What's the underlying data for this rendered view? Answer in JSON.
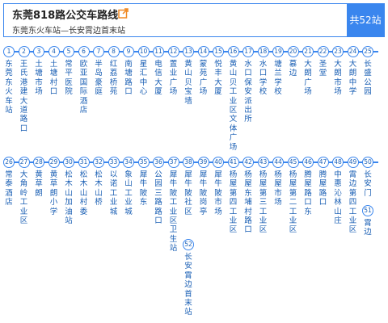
{
  "header": {
    "title": "东莞818路公交车路线",
    "subtitle": "东莞东火车站—长安霄边首末站",
    "stop_count_label": "共52站"
  },
  "row1": [
    {
      "num": "1",
      "name": "东莞东火车站"
    },
    {
      "num": "2",
      "name": "王氏港建大道路口"
    },
    {
      "num": "3",
      "name": "土塘市场"
    },
    {
      "num": "4",
      "name": "土塘村口"
    },
    {
      "num": "5",
      "name": "常平医院"
    },
    {
      "num": "6",
      "name": "欧亚国际酒店"
    },
    {
      "num": "7",
      "name": "半岛豪庭"
    },
    {
      "num": "8",
      "name": "红荔桥苑"
    },
    {
      "num": "9",
      "name": "南塘路口"
    },
    {
      "num": "10",
      "name": "星汇中心"
    },
    {
      "num": "11",
      "name": "电信大厦"
    },
    {
      "num": "12",
      "name": "置业广场"
    },
    {
      "num": "13",
      "name": "黄山贝宝墙"
    },
    {
      "num": "14",
      "name": "蒙苑广场"
    },
    {
      "num": "15",
      "name": "悦丰大厦"
    },
    {
      "num": "16",
      "name": "黄山贝工业区文体广场"
    },
    {
      "num": "17",
      "name": "水口保安派出所"
    },
    {
      "num": "18",
      "name": "水口学校"
    },
    {
      "num": "19",
      "name": "塘兰学校"
    },
    {
      "num": "20",
      "name": "慕边"
    },
    {
      "num": "21",
      "name": "大朗广场"
    },
    {
      "num": "22",
      "name": "圣堂"
    },
    {
      "num": "23",
      "name": "大朗市场"
    },
    {
      "num": "24",
      "name": "大朗中学"
    },
    {
      "num": "25",
      "name": "长盛公园"
    }
  ],
  "row2": [
    {
      "num": "26",
      "name": "常泰酒店"
    },
    {
      "num": "27",
      "name": "大角岭工业区"
    },
    {
      "num": "28",
      "name": "黄草朗"
    },
    {
      "num": "29",
      "name": "黄草朗小学"
    },
    {
      "num": "30",
      "name": "松木山加油站"
    },
    {
      "num": "31",
      "name": "松木山村委"
    },
    {
      "num": "32",
      "name": "松木山桥"
    },
    {
      "num": "33",
      "name": "以诺工业城"
    },
    {
      "num": "34",
      "name": "象山工业城"
    },
    {
      "num": "35",
      "name": "犀牛陂东"
    },
    {
      "num": "36",
      "name": "公园三路路口"
    },
    {
      "num": "37",
      "name": "犀牛陂工业区卫生站"
    },
    {
      "num": "38",
      "name": "犀牛陂社区"
    },
    {
      "num": "39",
      "name": "犀牛陂岗亭"
    },
    {
      "num": "40",
      "name": "犀牛陂市场"
    },
    {
      "num": "41",
      "name": "杨屋第四工业区"
    },
    {
      "num": "42",
      "name": "杨屋东埔村路口"
    },
    {
      "num": "43",
      "name": "杨屋第三工业区"
    },
    {
      "num": "44",
      "name": "杨屋市场"
    },
    {
      "num": "45",
      "name": "杨屋第二工业区"
    },
    {
      "num": "46",
      "name": "腾屋路口东"
    },
    {
      "num": "47",
      "name": "腾屋路口"
    },
    {
      "num": "48",
      "name": "中惠沁林山庄"
    },
    {
      "num": "49",
      "name": "霄边第四工业区"
    },
    {
      "num": "50",
      "name": "长安门"
    }
  ],
  "extra": [
    {
      "num": "51",
      "name": "霄边"
    },
    {
      "num": "52",
      "name": "长安霄边首末站"
    }
  ]
}
